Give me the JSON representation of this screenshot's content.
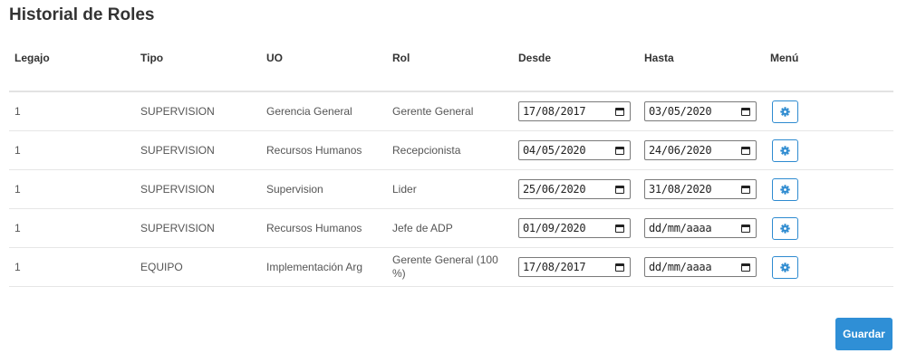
{
  "page": {
    "title": "Historial de Roles"
  },
  "table": {
    "headers": {
      "legajo": "Legajo",
      "tipo": "Tipo",
      "uo": "UO",
      "rol": "Rol",
      "desde": "Desde",
      "hasta": "Hasta",
      "menu": "Menú"
    },
    "rows": [
      {
        "legajo": "1",
        "tipo": "SUPERVISION",
        "uo": "Gerencia General",
        "rol": "Gerente General",
        "desde": "17/08/2017",
        "hasta": "03/05/2020"
      },
      {
        "legajo": "1",
        "tipo": "SUPERVISION",
        "uo": "Recursos Humanos",
        "rol": "Recepcionista",
        "desde": "04/05/2020",
        "hasta": "24/06/2020"
      },
      {
        "legajo": "1",
        "tipo": "SUPERVISION",
        "uo": "Supervision",
        "rol": "Lider",
        "desde": "25/06/2020",
        "hasta": "31/08/2020"
      },
      {
        "legajo": "1",
        "tipo": "SUPERVISION",
        "uo": "Recursos Humanos",
        "rol": "Jefe de ADP",
        "desde": "01/09/2020",
        "hasta": "dd/mm/aaaa"
      },
      {
        "legajo": "1",
        "tipo": "EQUIPO",
        "uo": "Implementación Arg",
        "rol": "Gerente General (100 %)",
        "desde": "17/08/2017",
        "hasta": "dd/mm/aaaa"
      }
    ],
    "menu_icon": "gear-icon",
    "date_icon": "calendar-icon"
  },
  "actions": {
    "save_label": "Guardar"
  },
  "colors": {
    "accent": "#2f8fd6",
    "border": "#e3e3e3"
  }
}
